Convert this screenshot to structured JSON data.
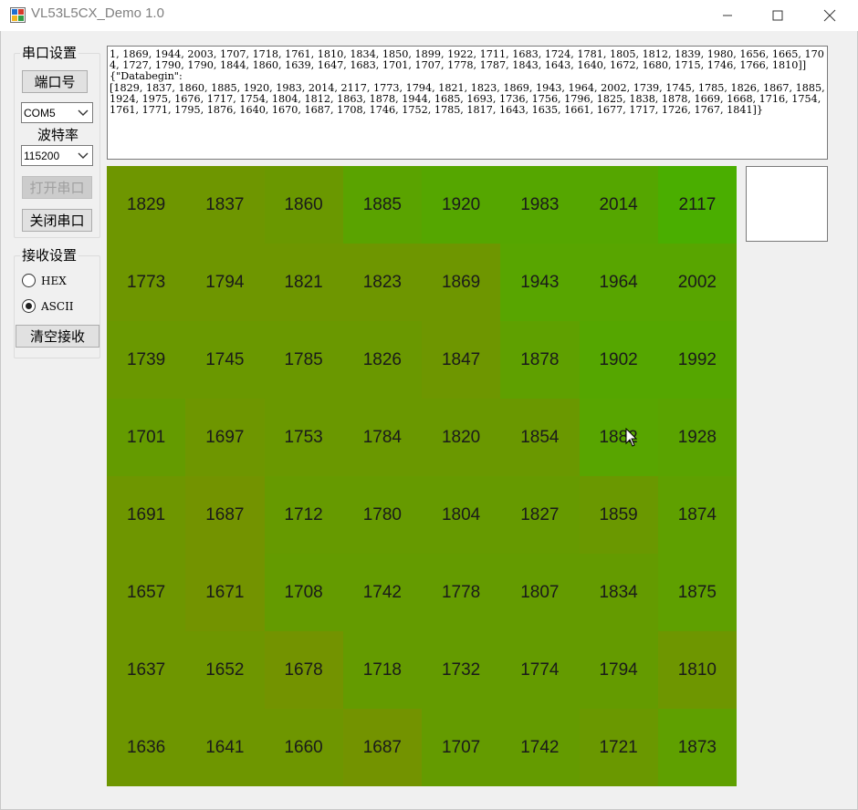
{
  "window": {
    "title": "VL53L5CX_Demo 1.0"
  },
  "serial_settings": {
    "group_title": "串口设置",
    "port_button": "端口号",
    "port_value": "COM5",
    "baud_label": "波特率",
    "baud_value": "115200",
    "open_button": "打开串口",
    "close_button": "关闭串口"
  },
  "receive_settings": {
    "group_title": "接收设置",
    "hex_label": "HEX",
    "ascii_label": "ASCII",
    "selected": "ASCII",
    "clear_button": "清空接收"
  },
  "receive_text": "1, 1869, 1944, 2003, 1707, 1718, 1761, 1810, 1834, 1850, 1899, 1922, 1711, 1683, 1724, 1781, 1805, 1812, 1839, 1980, 1656, 1665, 1704, 1727, 1790, 1790, 1844, 1860, 1639, 1647, 1683, 1701, 1707, 1778, 1787, 1843, 1643, 1640, 1672, 1680, 1715, 1746, 1766, 1810]]{\"Databegin\":\n[1829, 1837, 1860, 1885, 1920, 1983, 2014, 2117, 1773, 1794, 1821, 1823, 1869, 1943, 1964, 2002, 1739, 1745, 1785, 1826, 1867, 1885, 1924, 1975, 1676, 1717, 1754, 1804, 1812, 1863, 1878, 1944, 1685, 1693, 1736, 1756, 1796, 1825, 1838, 1878, 1669, 1668, 1716, 1754, 1761, 1771, 1795, 1876, 1640, 1670, 1687, 1708, 1746, 1752, 1785, 1817, 1643, 1635, 1661, 1677, 1717, 1726, 1767, 1841]}",
  "distance_grid": {
    "rows": [
      [
        "1829",
        "1837",
        "1860",
        "1885",
        "1920",
        "1983",
        "2014",
        "2117"
      ],
      [
        "1773",
        "1794",
        "1821",
        "1823",
        "1869",
        "1943",
        "1964",
        "2002"
      ],
      [
        "1739",
        "1745",
        "1785",
        "1826",
        "1847",
        "1878",
        "1902",
        "1992"
      ],
      [
        "1701",
        "1697",
        "1753",
        "1784",
        "1820",
        "1854",
        "1882",
        "1928"
      ],
      [
        "1691",
        "1687",
        "1712",
        "1780",
        "1804",
        "1827",
        "1859",
        "1874"
      ],
      [
        "1657",
        "1671",
        "1708",
        "1742",
        "1778",
        "1807",
        "1834",
        "1875"
      ],
      [
        "1637",
        "1652",
        "1678",
        "1718",
        "1732",
        "1774",
        "1794",
        "1810"
      ],
      [
        "1636",
        "1641",
        "1660",
        "1687",
        "1707",
        "1742",
        "1721",
        "1873"
      ]
    ],
    "colors": [
      [
        "#6e9600",
        "#6e9600",
        "#6a9800",
        "#5aa300",
        "#55a600",
        "#55a600",
        "#55a600",
        "#4aae00"
      ],
      [
        "#6e9600",
        "#6e9600",
        "#6e9600",
        "#6e9600",
        "#6e9600",
        "#58a500",
        "#58a500",
        "#58a500"
      ],
      [
        "#6a9800",
        "#6a9800",
        "#6a9800",
        "#6a9800",
        "#6e9600",
        "#5fa000",
        "#55a600",
        "#55a600"
      ],
      [
        "#649b00",
        "#6e9600",
        "#6a9800",
        "#6a9800",
        "#6a9800",
        "#6a9800",
        "#58a500",
        "#5aa300"
      ],
      [
        "#6e9600",
        "#739300",
        "#669a00",
        "#669a00",
        "#669a00",
        "#669a00",
        "#6a9800",
        "#5fa000"
      ],
      [
        "#6e9600",
        "#739300",
        "#649b00",
        "#649b00",
        "#649b00",
        "#649b00",
        "#649b00",
        "#5fa000"
      ],
      [
        "#6e9600",
        "#6e9600",
        "#739300",
        "#649b00",
        "#649b00",
        "#649b00",
        "#649b00",
        "#6e9600"
      ],
      [
        "#6e9600",
        "#6e9600",
        "#6e9600",
        "#739300",
        "#649b00",
        "#649b00",
        "#6a9800",
        "#5fa000"
      ]
    ]
  }
}
